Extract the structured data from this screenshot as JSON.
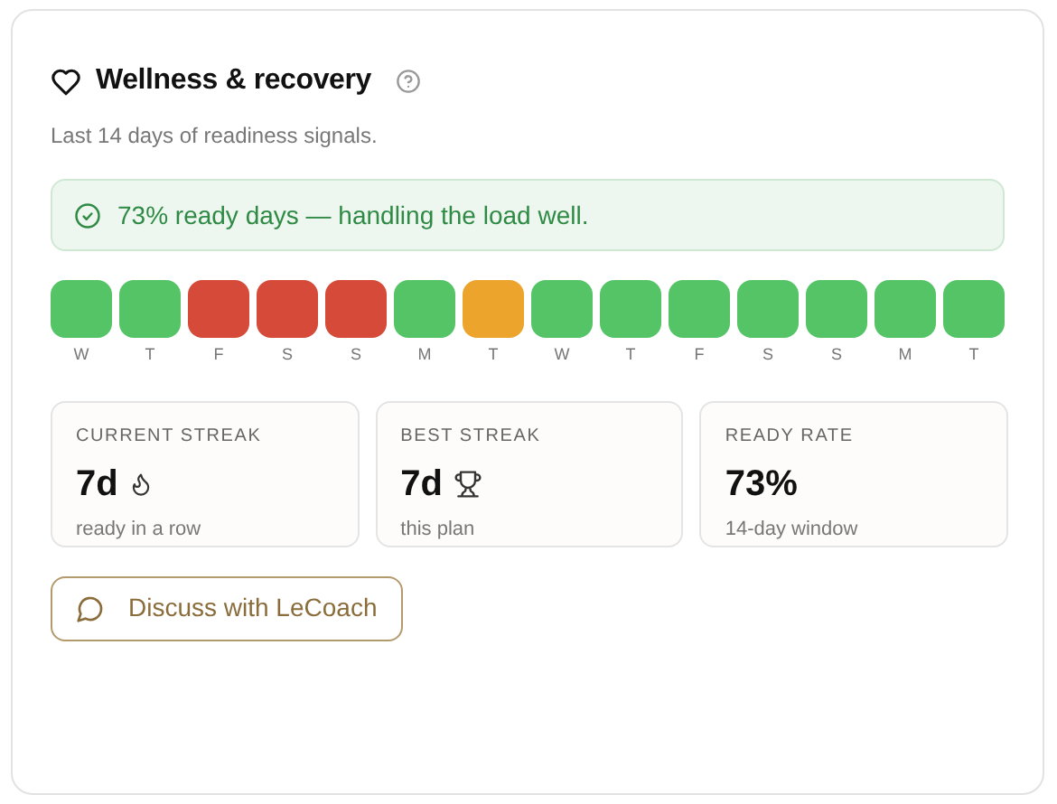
{
  "title": "Wellness & recovery",
  "subtitle": "Last 14 days of readiness signals.",
  "banner": "73% ready days — handling the load well.",
  "days": [
    {
      "label": "W",
      "color": "#54c466"
    },
    {
      "label": "T",
      "color": "#54c466"
    },
    {
      "label": "F",
      "color": "#d64a3a"
    },
    {
      "label": "S",
      "color": "#d64a3a"
    },
    {
      "label": "S",
      "color": "#d64a3a"
    },
    {
      "label": "M",
      "color": "#54c466"
    },
    {
      "label": "T",
      "color": "#eca42c"
    },
    {
      "label": "W",
      "color": "#54c466"
    },
    {
      "label": "T",
      "color": "#54c466"
    },
    {
      "label": "F",
      "color": "#54c466"
    },
    {
      "label": "S",
      "color": "#54c466"
    },
    {
      "label": "S",
      "color": "#54c466"
    },
    {
      "label": "M",
      "color": "#54c466"
    },
    {
      "label": "T",
      "color": "#54c466"
    }
  ],
  "stats": [
    {
      "kind": "streak",
      "label": "CURRENT STREAK",
      "value": "7d",
      "caption": "ready in a row"
    },
    {
      "kind": "best",
      "label": "BEST STREAK",
      "value": "7d",
      "caption": "this plan"
    },
    {
      "kind": "rate",
      "label": "READY RATE",
      "value": "73%",
      "caption": "14-day window"
    }
  ],
  "button": "Discuss with LeCoach"
}
